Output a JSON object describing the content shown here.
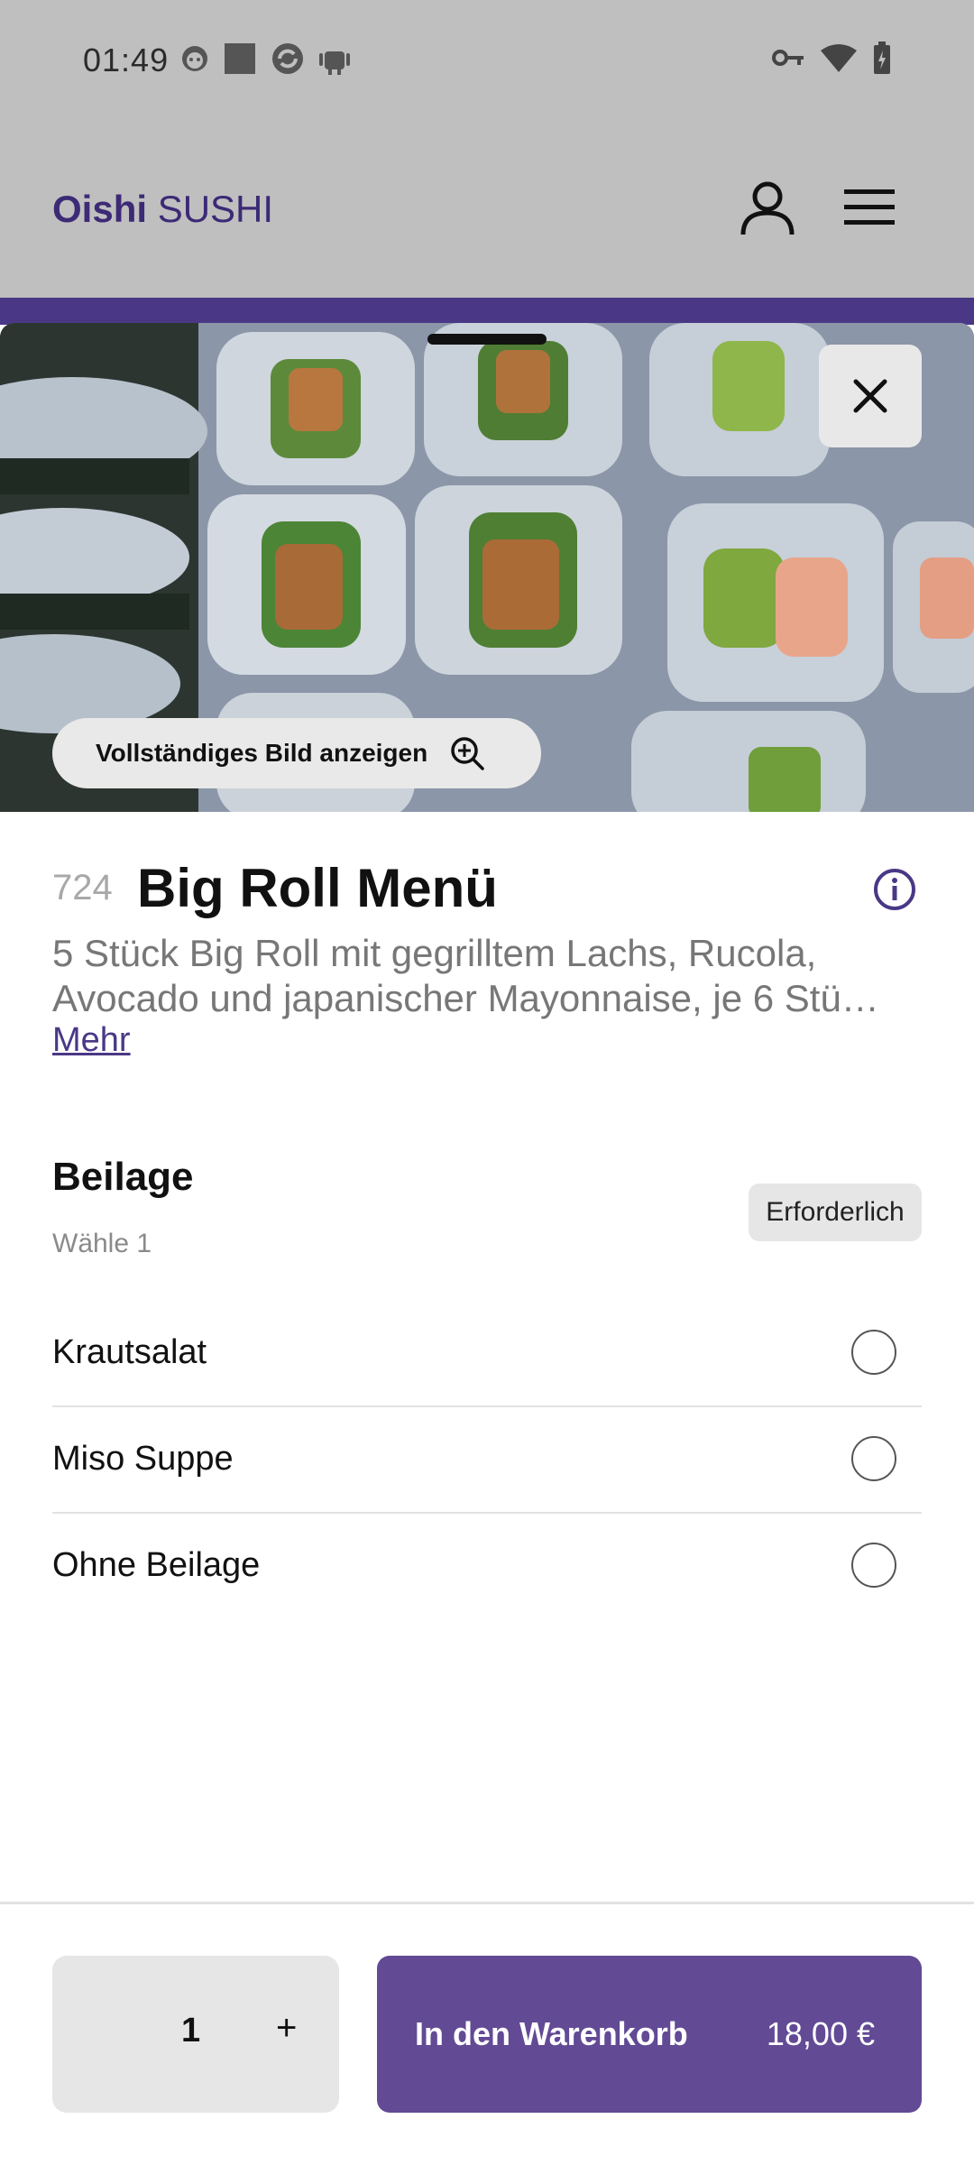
{
  "status_bar": {
    "time": "01:49"
  },
  "app": {
    "logo_mark": "Oishi",
    "logo_text": "SUSHI"
  },
  "hero": {
    "full_image_label": "Vollständiges Bild anzeigen"
  },
  "product": {
    "number": "724",
    "title": "Big Roll Menü",
    "description_line1": "5 Stück Big Roll mit gegrilltem Lachs, Rucola,",
    "description_line2": "Avocado und japanischer Mayonnaise, je 6 Stü…",
    "more_label": "Mehr"
  },
  "section": {
    "title": "Beilage",
    "subtitle": "Wähle 1",
    "badge": "Erforderlich",
    "options": [
      {
        "label": "Krautsalat",
        "selected": false
      },
      {
        "label": "Miso Suppe",
        "selected": false
      },
      {
        "label": "Ohne Beilage",
        "selected": false
      }
    ]
  },
  "footer": {
    "quantity": "1",
    "plus_label": "+",
    "add_to_cart": "In den Warenkorb",
    "price": "18,00 €"
  },
  "colors": {
    "brand": "#4a3886",
    "button": "#624a95",
    "overlay": "#bfbfbf"
  },
  "icons": [
    "user-icon",
    "menu-icon",
    "close-icon",
    "zoom-in-icon",
    "info-icon"
  ]
}
